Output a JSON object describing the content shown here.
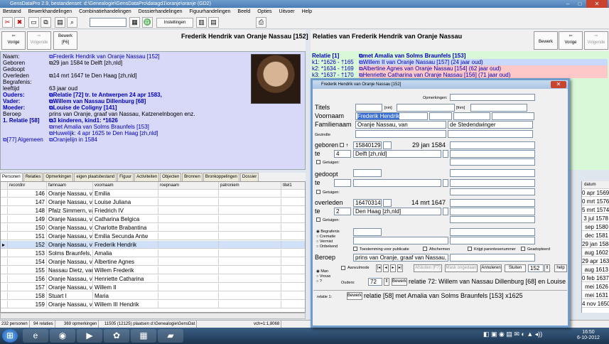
{
  "window": {
    "title": "GensDataPro 2.9, bestandenset: d:\\Genealogie\\GensDataPro\\datagd1\\oranje\\oranje (GD2)"
  },
  "menu": [
    "Bestand",
    "Bewerkhandelingen",
    "Combinatiehandelingen",
    "Dossierhandelingen",
    "Figuurhandelingen",
    "Beeld",
    "Opties",
    "Uitvoer",
    "Help"
  ],
  "toolbar": {
    "instellingen_label": "Instellingen"
  },
  "nav": {
    "vorige": "Vorige",
    "volgende": "Volgende",
    "bewerk": "Bewerk",
    "bewerk_key": "[F6]"
  },
  "person": {
    "heading": "Frederik Hendrik van Oranje Nassau [152]",
    "naam_label": "Naam:",
    "naam_value": "Frederik Hendrik van Oranje Nassau [152]",
    "geboren_label": "Geboren",
    "geboren_value": "29 jan 1584 te Delft [zh,nld]",
    "gedoopt_label": "Gedoopt",
    "overleden_label": "Overleden",
    "overleden_value": "14 mrt 1647 te Den Haag [zh,nld]",
    "begrafenis_label": "Begrafenis:",
    "leeftijd_label": "leeftijd",
    "leeftijd_value": "63 jaar oud",
    "ouders_label": "Ouders:",
    "ouders_value": "Relatie [72] tr. te Antwerpen 24 apr 1583,",
    "vader_label": "Vader:",
    "vader_value": "Willem van Nassau Dillenburg [68]",
    "moeder_label": "Moeder:",
    "moeder_value": "Louise de Coligny [141]",
    "beroep_label": "Beroep",
    "beroep_value": "prins van Oranje, graaf van Nassau, Katzenelnbogen enz.",
    "relatie_label": "1. Relatie [58]",
    "kinderen_value": "3 kinderen, kind1: *1626",
    "partner_value": "met Amalia van Solms Braunfels [153]",
    "huwelijk_value": "Huwelijk: 4 apr 1625 te Den Haag [zh,nld]",
    "algemeen_label": "[77] Algemeen",
    "algemeen_value": "Oranjelijn in 1584"
  },
  "relations": {
    "heading": "Relaties van Frederik Hendrik van Oranje Nassau",
    "rows": [
      {
        "left": "Relatie [1]",
        "right": "met Amalia van Solms Braunfels [153]"
      },
      {
        "left": "k1: *1626 - †165",
        "right": "Willem II van Oranje Nassau [157] (24 jaar oud)"
      },
      {
        "left": "k2: *1634 - †169",
        "right": "Albertine Agnes van Oranje Nassau [154] (62 jaar oud)"
      },
      {
        "left": "k3: *1637 - †170",
        "right": "Henriette Catharina van Oranje Nassau [156] (71 jaar oud)"
      }
    ]
  },
  "tabs": [
    "Personen",
    "Relaties",
    "Opmerkingen",
    "eigen plaatsbestand",
    "Figuur",
    "Activiteiten",
    "Objecten",
    "Bronnen",
    "Bronkoppelingen",
    "Dossier"
  ],
  "grid": {
    "columns": [
      "recordnr",
      "famnaam",
      "voornaam",
      "roepnaam",
      "patroniem",
      "titel1"
    ],
    "rows": [
      [
        "146",
        "Oranje Nassau, van",
        "Emilia"
      ],
      [
        "147",
        "Oranje Nassau, van",
        "Louise Juliana"
      ],
      [
        "148",
        "Pfalz Simmern, van",
        "Friedrich IV"
      ],
      [
        "149",
        "Oranje Nassau, van",
        "Catharina Belgica"
      ],
      [
        "150",
        "Oranje Nassau, van",
        "Charlotte Brabantina"
      ],
      [
        "151",
        "Oranje Nassau, van",
        "Emilia Secunda Antw"
      ],
      [
        "152",
        "Oranje Nassau, van",
        "Frederik Hendrik"
      ],
      [
        "153",
        "Solms Braunfels, van",
        "Amalia"
      ],
      [
        "154",
        "Oranje Nassau, van",
        "Albertine Agnes"
      ],
      [
        "155",
        "Nassau Dietz, van",
        "Willem Frederik"
      ],
      [
        "156",
        "Oranje Nassau, van",
        "Henriette Catharina"
      ],
      [
        "157",
        "Oranje Nassau, van",
        "Willem II"
      ],
      [
        "158",
        "Stuart I",
        "Maria"
      ],
      [
        "159",
        "Oranje Nassau, van",
        "Willem III Hendrik"
      ]
    ],
    "datum_header": "datum",
    "datum": [
      "0 apr 1569",
      "0 mrt 1576",
      "5 mrt 1574",
      "3 jul 1578",
      "sep 1580",
      "dec 1581",
      "29 jan 1584",
      "aug 1602",
      "29 apr 1634",
      "aug 1613",
      "0 feb 1637",
      "mei 1626",
      "mei 1631",
      "4 nov 1650"
    ]
  },
  "status": [
    "232 personen",
    "94 relaties",
    "369 opmerkingen",
    "11505 (12125) plaatsen d:\\Genealogie\\GensDat",
    "vch=1:1,8068"
  ],
  "clock": {
    "time": "16:50",
    "date": "6-10-2012"
  },
  "dialog": {
    "title": "Frederik Hendrik van Oranje Nassau [152]",
    "opmerkingen": "Opmerkingen:",
    "titels": "Titels",
    "nm": "[nm]",
    "fnm": "[fnm]",
    "voornaam": "Voornaam",
    "voornaam_value": "Frederik Hendrik",
    "familienaam": "Familienaam",
    "familienaam_value": "Oranje Nassau, van",
    "familienaam_extra": "de Stedendwinger",
    "gezindte": "Gezindte",
    "geboren": "geboren",
    "geboren_code": "15840129",
    "geboren_date": "29 jan 1584",
    "te": "te",
    "geb_te_num": "4",
    "geb_te_value": "Delft [zh,nld]",
    "getuigen": "Getuigen:",
    "gedoopt": "gedoopt",
    "overleden": "overleden",
    "overleden_code": "16470314",
    "overleden_date": "14 mrt 1647",
    "ovl_te_num": "2",
    "ovl_te_value": "Den Haag [zh,nld]",
    "begrafenis": "Begrafenis",
    "crematie": "Crematie",
    "vermist": "Vermist",
    "onbekend": "Onbekend",
    "toestemming": "Toestemming voor publicatie",
    "afschermen": "Afschermen",
    "krijgt": "Krijgt parentesenummer",
    "geadopteerd": "Geadopteerd",
    "beroep": "Beroep",
    "beroep_value": "prins van Oranje, graaf van Nassau,",
    "aanvulmode": "Aanvulmode",
    "nav_prev": "Afsluiten (F7)",
    "nav_next": "Mask ongedaan",
    "annuleren": "Annuleren",
    "sluiten": "Sluiten",
    "count": "152",
    "help": "help",
    "man": "Man",
    "vrouw": "Vrouw",
    "unknown": "?",
    "ouders": "Ouders:",
    "ouders_num": "72",
    "bewerk": "Bewerk",
    "ouders_value": "relatie 72: Willem van Nassau Dillenburg [68] en Louise",
    "relatie1": "relatie 1:",
    "relatie1_value": "relatie [58]  met Amalia van Solms Braunfels [153] x1625"
  }
}
